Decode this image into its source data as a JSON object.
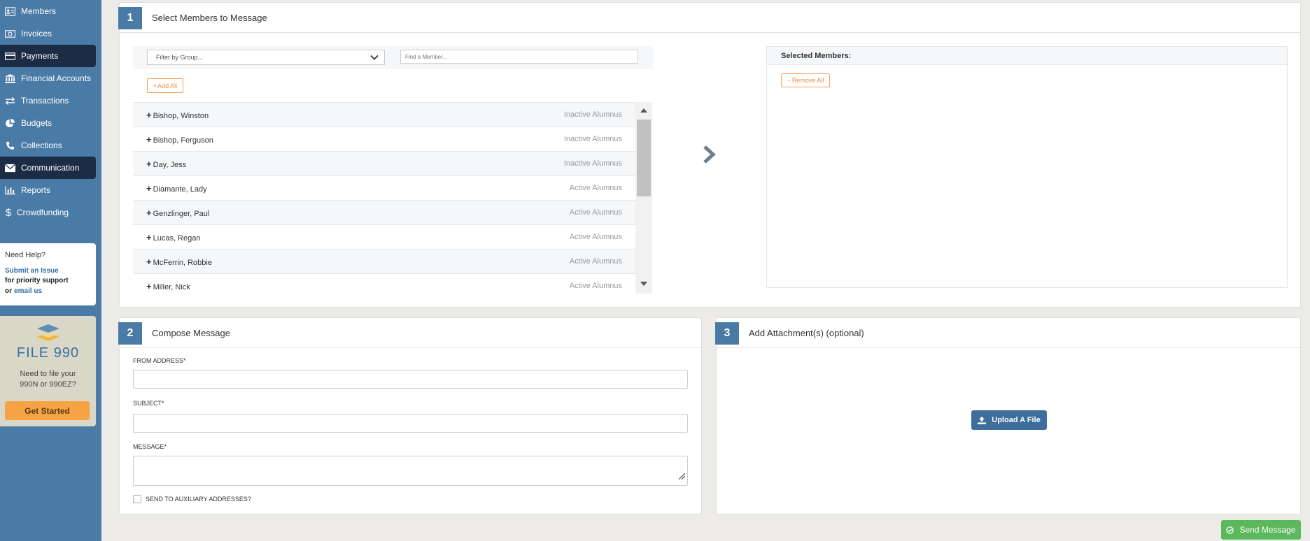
{
  "sidebar": {
    "items": [
      {
        "label": "Members",
        "icon": "id-card-icon",
        "active": false
      },
      {
        "label": "Invoices",
        "icon": "money-icon",
        "active": false
      },
      {
        "label": "Payments",
        "icon": "credit-card-icon",
        "active": true
      },
      {
        "label": "Financial Accounts",
        "icon": "bank-icon",
        "active": false
      },
      {
        "label": "Transactions",
        "icon": "exchange-icon",
        "active": false
      },
      {
        "label": "Budgets",
        "icon": "pie-chart-icon",
        "active": false
      },
      {
        "label": "Collections",
        "icon": "phone-icon",
        "active": false
      },
      {
        "label": "Communication",
        "icon": "envelope-icon",
        "active": true
      },
      {
        "label": "Reports",
        "icon": "bar-chart-icon",
        "active": false
      },
      {
        "label": "Crowdfunding",
        "icon": "dollar-icon",
        "active": false
      }
    ],
    "help": {
      "title": "Need Help?",
      "submit_link": "Submit an Issue",
      "priority_text": "for priority support",
      "or_text": "or",
      "email_link": "email us"
    },
    "promo": {
      "title": "FILE 990",
      "desc_line1": "Need to file your",
      "desc_line2": "990N or 990EZ?",
      "button": "Get Started"
    }
  },
  "step1": {
    "number": "1",
    "title": "Select Members to Message",
    "filter_placeholder": "Filter by Group...",
    "search_placeholder": "Find a Member...",
    "add_all": "Add All",
    "members": [
      {
        "name": "Bishop, Winston",
        "status": "Inactive Alumnus"
      },
      {
        "name": "Bishop, Ferguson",
        "status": "Inactive Alumnus"
      },
      {
        "name": "Day, Jess",
        "status": "Inactive Alumnus"
      },
      {
        "name": "Diamante, Lady",
        "status": "Active Alumnus"
      },
      {
        "name": "Genzlinger, Paul",
        "status": "Active Alumnus"
      },
      {
        "name": "Lucas, Regan",
        "status": "Active Alumnus"
      },
      {
        "name": "McFerrin, Robbie",
        "status": "Active Alumnus"
      },
      {
        "name": "Miller, Nick",
        "status": "Active Alumnus"
      }
    ],
    "selected_title": "Selected Members:",
    "remove_all": "Remove All"
  },
  "step2": {
    "number": "2",
    "title": "Compose Message",
    "from_label": "FROM ADDRESS*",
    "subject_label": "SUBJECT*",
    "message_label": "MESSAGE*",
    "aux_label": "SEND TO AUXILIARY ADDRESSES?"
  },
  "step3": {
    "number": "3",
    "title": "Add Attachment(s) (optional)",
    "upload": "Upload A File"
  },
  "send_button": "Send Message",
  "colors": {
    "sidebar": "#4a7ba6",
    "active_nav": "#1c2c45",
    "accent_orange": "#f08a3c",
    "send_green": "#5cb85c",
    "upload_blue": "#3e6e9c"
  }
}
